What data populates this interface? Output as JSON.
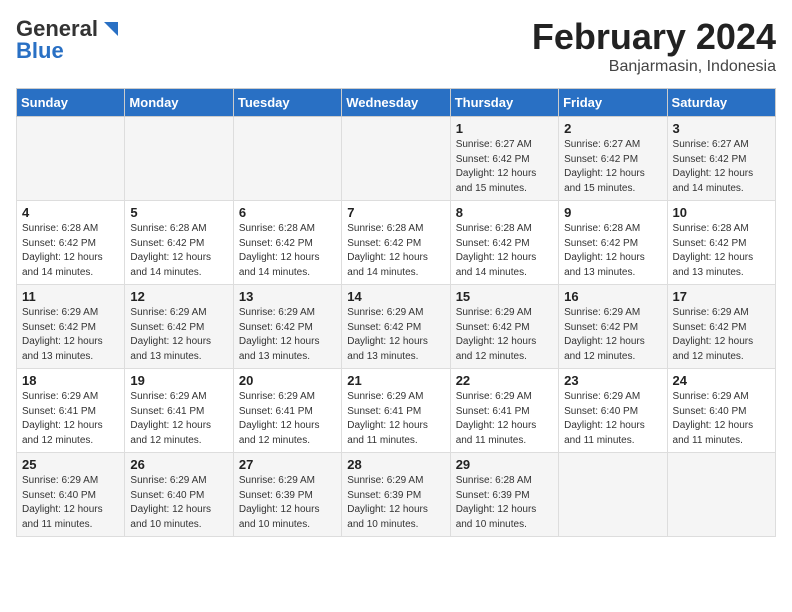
{
  "app": {
    "logo_line1": "General",
    "logo_line2": "Blue"
  },
  "title": "February 2024",
  "subtitle": "Banjarmasin, Indonesia",
  "days_of_week": [
    "Sunday",
    "Monday",
    "Tuesday",
    "Wednesday",
    "Thursday",
    "Friday",
    "Saturday"
  ],
  "weeks": [
    [
      {
        "day": "",
        "info": ""
      },
      {
        "day": "",
        "info": ""
      },
      {
        "day": "",
        "info": ""
      },
      {
        "day": "",
        "info": ""
      },
      {
        "day": "1",
        "info": "Sunrise: 6:27 AM\nSunset: 6:42 PM\nDaylight: 12 hours\nand 15 minutes."
      },
      {
        "day": "2",
        "info": "Sunrise: 6:27 AM\nSunset: 6:42 PM\nDaylight: 12 hours\nand 15 minutes."
      },
      {
        "day": "3",
        "info": "Sunrise: 6:27 AM\nSunset: 6:42 PM\nDaylight: 12 hours\nand 14 minutes."
      }
    ],
    [
      {
        "day": "4",
        "info": "Sunrise: 6:28 AM\nSunset: 6:42 PM\nDaylight: 12 hours\nand 14 minutes."
      },
      {
        "day": "5",
        "info": "Sunrise: 6:28 AM\nSunset: 6:42 PM\nDaylight: 12 hours\nand 14 minutes."
      },
      {
        "day": "6",
        "info": "Sunrise: 6:28 AM\nSunset: 6:42 PM\nDaylight: 12 hours\nand 14 minutes."
      },
      {
        "day": "7",
        "info": "Sunrise: 6:28 AM\nSunset: 6:42 PM\nDaylight: 12 hours\nand 14 minutes."
      },
      {
        "day": "8",
        "info": "Sunrise: 6:28 AM\nSunset: 6:42 PM\nDaylight: 12 hours\nand 14 minutes."
      },
      {
        "day": "9",
        "info": "Sunrise: 6:28 AM\nSunset: 6:42 PM\nDaylight: 12 hours\nand 13 minutes."
      },
      {
        "day": "10",
        "info": "Sunrise: 6:28 AM\nSunset: 6:42 PM\nDaylight: 12 hours\nand 13 minutes."
      }
    ],
    [
      {
        "day": "11",
        "info": "Sunrise: 6:29 AM\nSunset: 6:42 PM\nDaylight: 12 hours\nand 13 minutes."
      },
      {
        "day": "12",
        "info": "Sunrise: 6:29 AM\nSunset: 6:42 PM\nDaylight: 12 hours\nand 13 minutes."
      },
      {
        "day": "13",
        "info": "Sunrise: 6:29 AM\nSunset: 6:42 PM\nDaylight: 12 hours\nand 13 minutes."
      },
      {
        "day": "14",
        "info": "Sunrise: 6:29 AM\nSunset: 6:42 PM\nDaylight: 12 hours\nand 13 minutes."
      },
      {
        "day": "15",
        "info": "Sunrise: 6:29 AM\nSunset: 6:42 PM\nDaylight: 12 hours\nand 12 minutes."
      },
      {
        "day": "16",
        "info": "Sunrise: 6:29 AM\nSunset: 6:42 PM\nDaylight: 12 hours\nand 12 minutes."
      },
      {
        "day": "17",
        "info": "Sunrise: 6:29 AM\nSunset: 6:42 PM\nDaylight: 12 hours\nand 12 minutes."
      }
    ],
    [
      {
        "day": "18",
        "info": "Sunrise: 6:29 AM\nSunset: 6:41 PM\nDaylight: 12 hours\nand 12 minutes."
      },
      {
        "day": "19",
        "info": "Sunrise: 6:29 AM\nSunset: 6:41 PM\nDaylight: 12 hours\nand 12 minutes."
      },
      {
        "day": "20",
        "info": "Sunrise: 6:29 AM\nSunset: 6:41 PM\nDaylight: 12 hours\nand 12 minutes."
      },
      {
        "day": "21",
        "info": "Sunrise: 6:29 AM\nSunset: 6:41 PM\nDaylight: 12 hours\nand 11 minutes."
      },
      {
        "day": "22",
        "info": "Sunrise: 6:29 AM\nSunset: 6:41 PM\nDaylight: 12 hours\nand 11 minutes."
      },
      {
        "day": "23",
        "info": "Sunrise: 6:29 AM\nSunset: 6:40 PM\nDaylight: 12 hours\nand 11 minutes."
      },
      {
        "day": "24",
        "info": "Sunrise: 6:29 AM\nSunset: 6:40 PM\nDaylight: 12 hours\nand 11 minutes."
      }
    ],
    [
      {
        "day": "25",
        "info": "Sunrise: 6:29 AM\nSunset: 6:40 PM\nDaylight: 12 hours\nand 11 minutes."
      },
      {
        "day": "26",
        "info": "Sunrise: 6:29 AM\nSunset: 6:40 PM\nDaylight: 12 hours\nand 10 minutes."
      },
      {
        "day": "27",
        "info": "Sunrise: 6:29 AM\nSunset: 6:39 PM\nDaylight: 12 hours\nand 10 minutes."
      },
      {
        "day": "28",
        "info": "Sunrise: 6:29 AM\nSunset: 6:39 PM\nDaylight: 12 hours\nand 10 minutes."
      },
      {
        "day": "29",
        "info": "Sunrise: 6:28 AM\nSunset: 6:39 PM\nDaylight: 12 hours\nand 10 minutes."
      },
      {
        "day": "",
        "info": ""
      },
      {
        "day": "",
        "info": ""
      }
    ]
  ]
}
